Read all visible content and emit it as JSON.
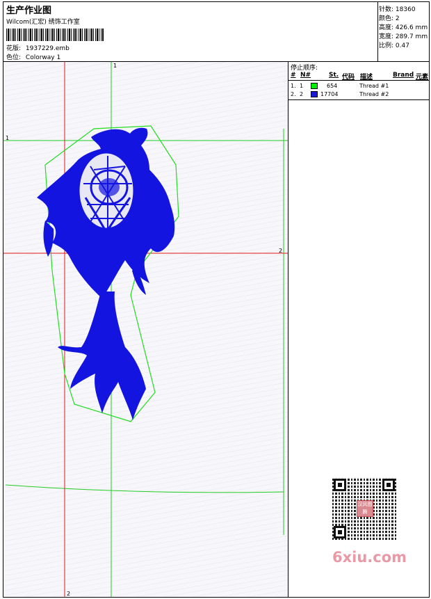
{
  "header": {
    "title": "生产作业图",
    "subtitle": "Wilcom(汇宏) 绣饰工作室",
    "design_label": "花版:",
    "design_file": "1937229.emb",
    "colorway_label": "色位:",
    "colorway": "Colorway 1"
  },
  "stats": {
    "stitches_label": "针数:",
    "stitches": "18360",
    "colors_label": "颜色:",
    "colors": "2",
    "height_label": "高度:",
    "height": "426.6 mm",
    "width_label": "宽度:",
    "width": "289.7 mm",
    "scale_label": "比例:",
    "scale": "0.47"
  },
  "stop_sequence": {
    "title": "停止顺序:",
    "columns": {
      "hash": "#",
      "no": "N#",
      "st": "St.",
      "code": "代码",
      "desc": "描述",
      "brand": "Brand",
      "element": "元素"
    },
    "rows": [
      {
        "index": "1.",
        "n": "1",
        "color": "#00ee00",
        "stitches": "654",
        "desc": "Thread #1"
      },
      {
        "index": "2.",
        "n": "2",
        "color": "#1a1ad6",
        "stitches": "17704",
        "desc": "Thread #2"
      }
    ]
  },
  "guides": {
    "v1": "1",
    "h1": "1",
    "h2": "2",
    "v2": "2"
  },
  "colors": {
    "embroidery": "#1414e0",
    "outline": "#22dd22",
    "red_guide": "#e01818",
    "green_guide": "#22cc22"
  },
  "qr": {
    "center_text": "汉风图腾"
  },
  "watermark": "6xiu.com"
}
